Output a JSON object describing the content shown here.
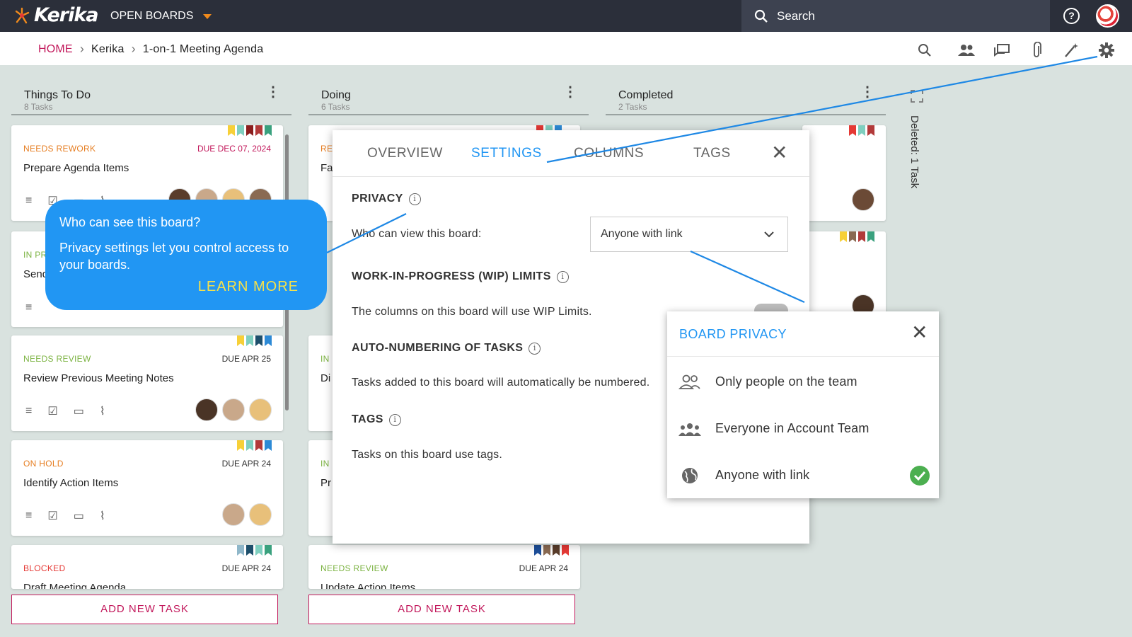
{
  "topbar": {
    "logo": "Kerika",
    "open_boards": "OPEN BOARDS",
    "search_placeholder": "Search",
    "help_icon": "help-circle-icon"
  },
  "breadcrumb": {
    "home": "HOME",
    "workspace": "Kerika",
    "board": "1-on-1 Meeting Agenda"
  },
  "toolbar_icons": [
    "search-icon",
    "people-icon",
    "chat-icon",
    "paperclip-icon",
    "wand-icon",
    "gear-icon"
  ],
  "columns": [
    {
      "title": "Things To Do",
      "count": "8 Tasks"
    },
    {
      "title": "Doing",
      "count": "6 Tasks"
    },
    {
      "title": "Completed",
      "count": "2 Tasks"
    }
  ],
  "cards_col1": [
    {
      "status": "NEEDS REWORK",
      "due": "DUE DEC 07, 2024",
      "title": "Prepare Agenda Items",
      "status_color": "#e67e22",
      "due_color": "#c2185b"
    },
    {
      "status": "IN PROGRESS",
      "title": "Send"
    },
    {
      "status": "NEEDS REVIEW",
      "due": "DUE APR 25",
      "title": "Review Previous Meeting Notes",
      "status_color": "#7cb342"
    },
    {
      "status": "ON HOLD",
      "due": "DUE APR 24",
      "title": "Identify Action Items",
      "status_color": "#e67e22"
    },
    {
      "status": "BLOCKED",
      "due": "DUE APR 24",
      "title": "Draft Meeting Agenda",
      "status_color": "#e53935"
    }
  ],
  "cards_col2": [
    {
      "status": "RE",
      "title": "Fa"
    },
    {
      "status": "IN",
      "title": "Di"
    },
    {
      "status": "IN",
      "title": "Pr"
    },
    {
      "status": "NEEDS REVIEW",
      "due": "DUE APR 24",
      "title": "Update Action Items"
    }
  ],
  "add_task": "ADD NEW TASK",
  "deleted": "Deleted: 1 Task",
  "check_count": "1",
  "settings": {
    "tabs": [
      "OVERVIEW",
      "SETTINGS",
      "COLUMNS",
      "TAGS"
    ],
    "active_tab": "SETTINGS",
    "privacy_heading": "PRIVACY",
    "privacy_label": "Who can view this board:",
    "privacy_value": "Anyone with link",
    "wip_heading": "WORK-IN-PROGRESS (WIP) LIMITS",
    "wip_text": "The columns on this board will use WIP Limits.",
    "autonum_heading": "AUTO-NUMBERING OF TASKS",
    "autonum_text": "Tasks added to this board will automatically be numbered.",
    "tags_heading": "TAGS",
    "tags_text": "Tasks on this board use tags."
  },
  "privacy_menu": {
    "title": "BOARD PRIVACY",
    "options": [
      "Only people on the team",
      "Everyone in Account Team",
      "Anyone with link"
    ],
    "selected": "Anyone with link"
  },
  "tooltip": {
    "question": "Who can see this board?",
    "body": "Privacy settings let you control access to your boards.",
    "link": "LEARN MORE"
  },
  "colors": {
    "accent": "#2196f3",
    "brand": "#c2185b",
    "topbar": "#2b2f3a",
    "board_bg": "#d9e2df"
  }
}
